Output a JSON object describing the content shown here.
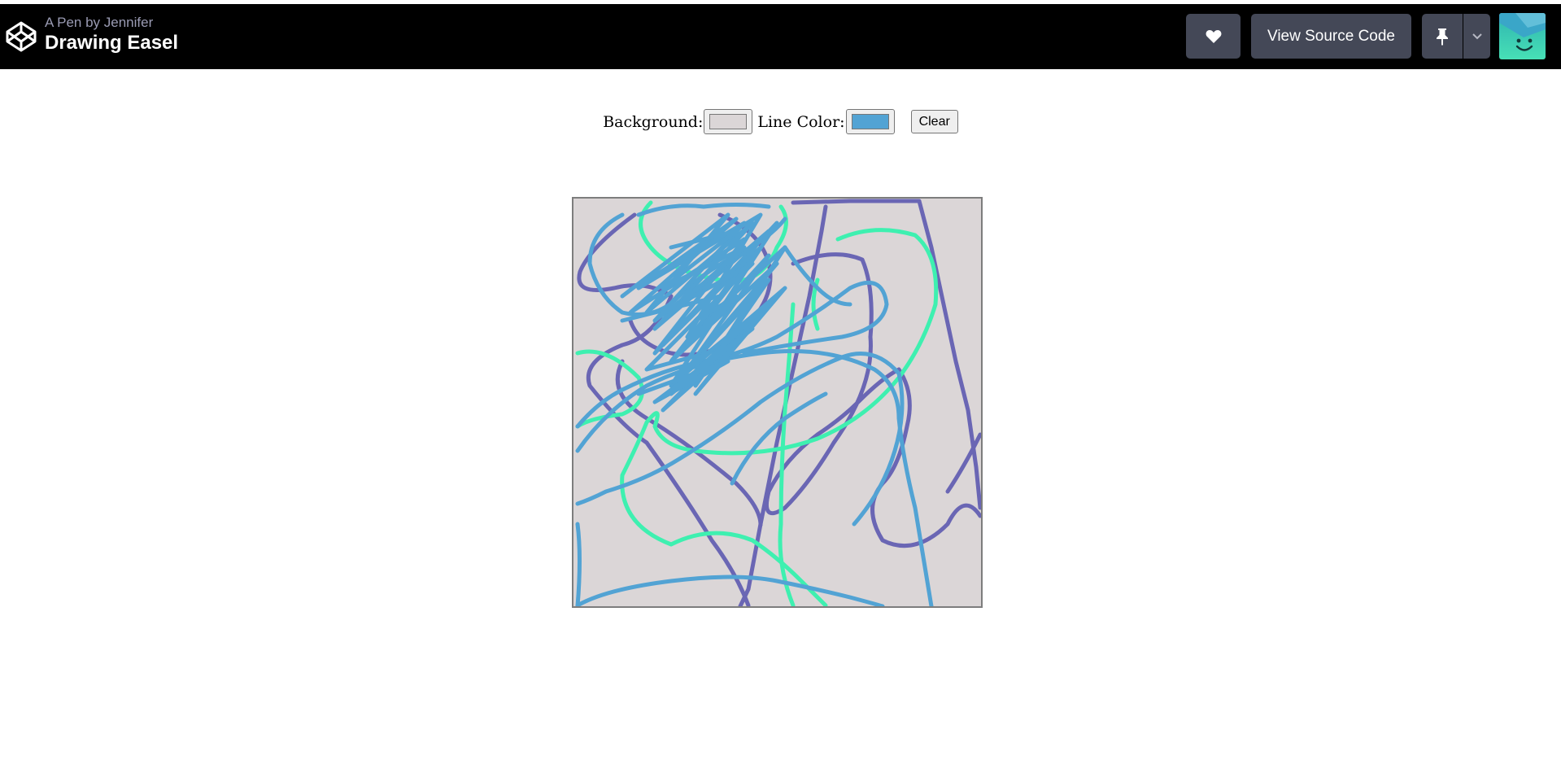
{
  "header": {
    "byline": "A Pen by Jennifer",
    "title": "Drawing Easel",
    "view_source_label": "View Source Code",
    "icons": [
      "codepen-logo-icon",
      "heart-icon",
      "pin-icon",
      "chevron-down-icon"
    ]
  },
  "controls": {
    "background_label": "Background:",
    "background_color": "#dbd6d7",
    "line_color_label": "Line Color:",
    "line_color": "#52a3d4",
    "clear_label": "Clear"
  },
  "canvas": {
    "background": "#dbd6d7",
    "stroke_colors": [
      "#6a66b4",
      "#3ef0b0",
      "#52a3d4"
    ]
  }
}
